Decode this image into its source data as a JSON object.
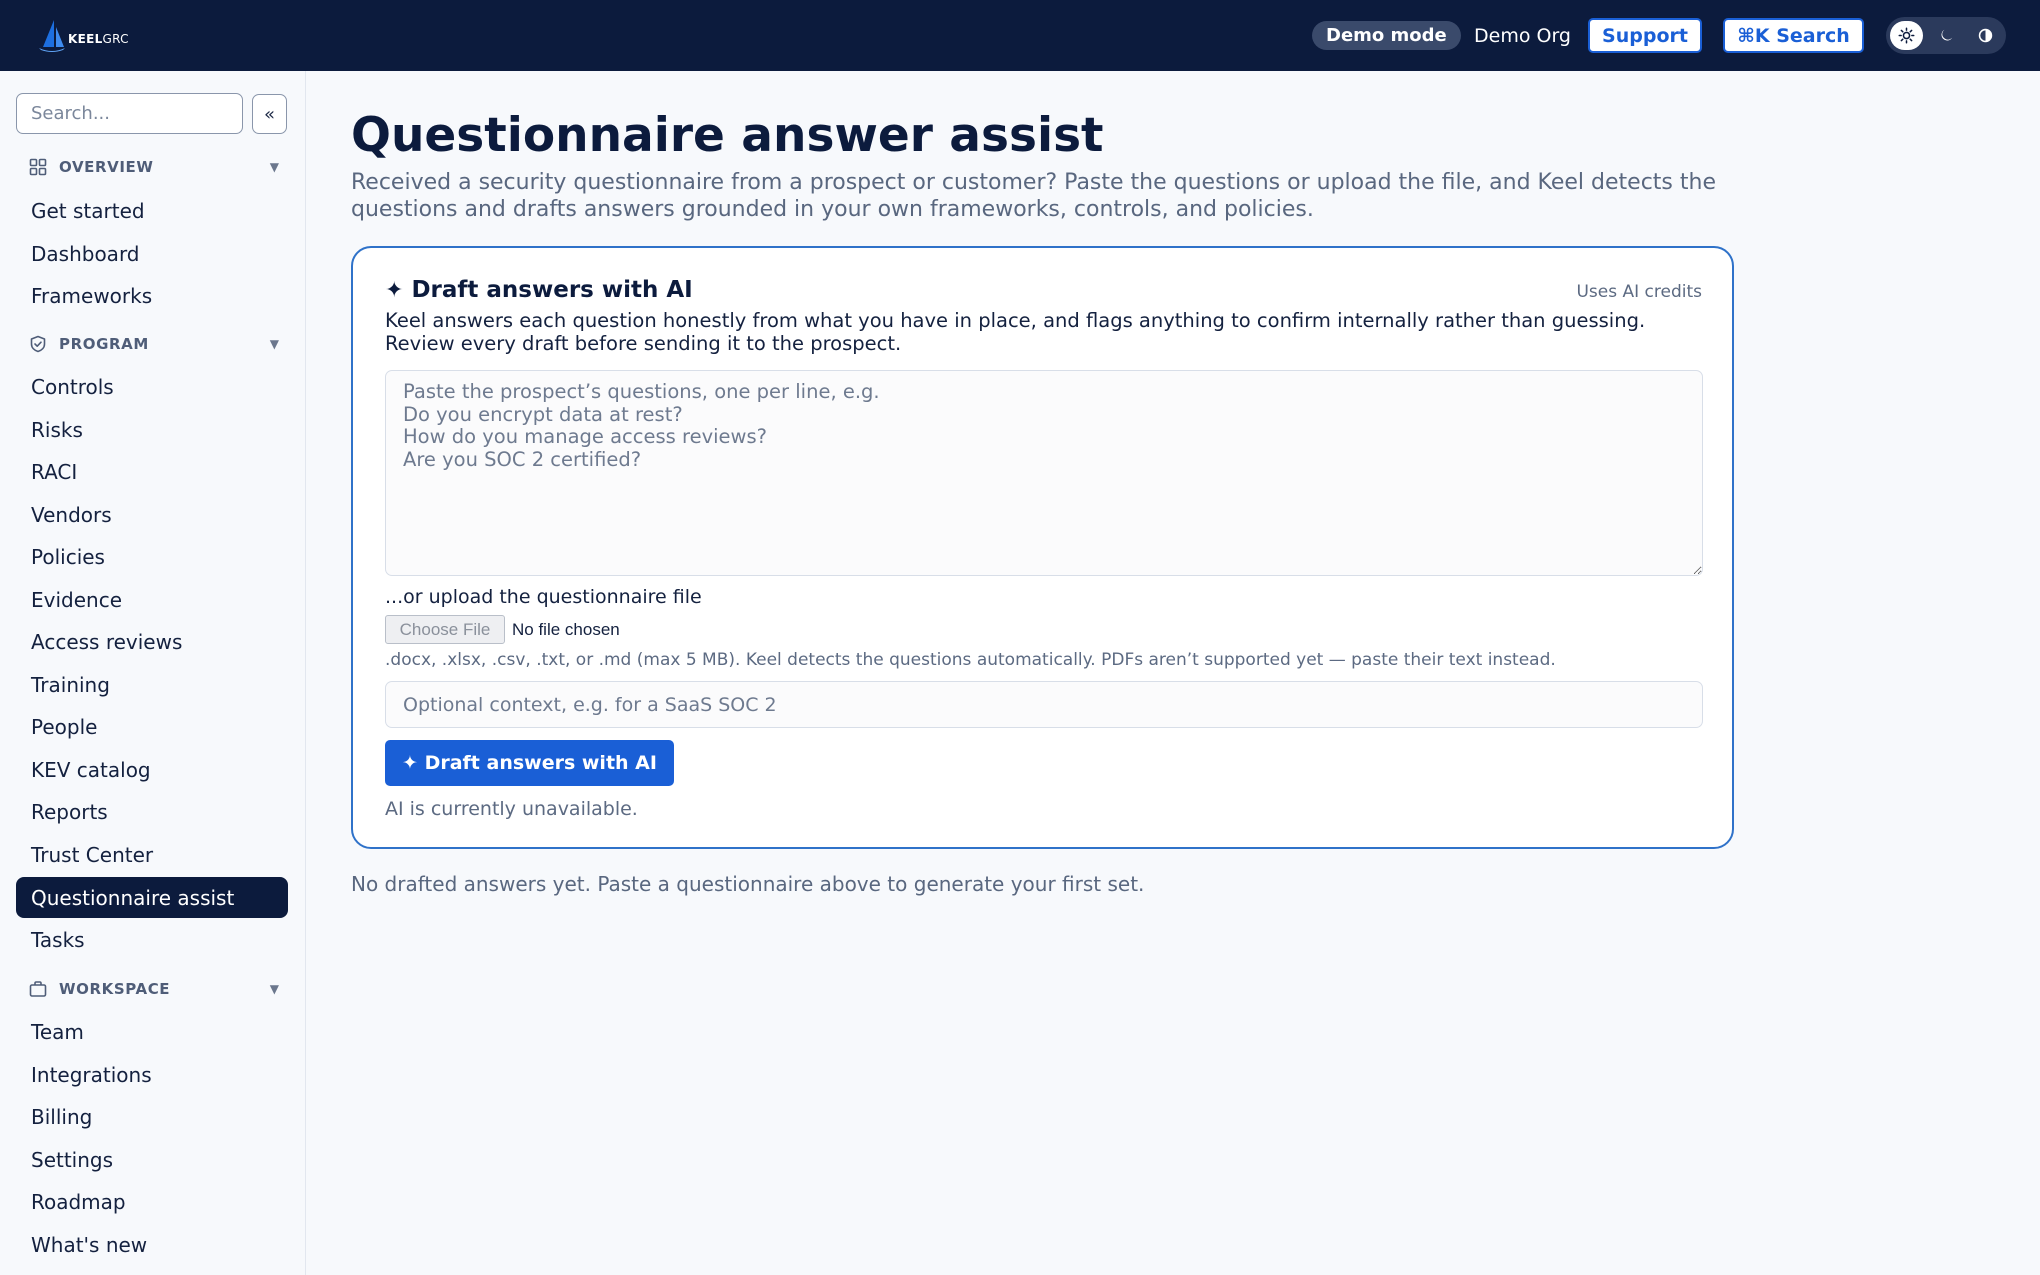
{
  "brand": {
    "name_bold": "KEEL",
    "name_light": "GRC"
  },
  "topbar": {
    "demo_badge": "Demo mode",
    "org_name": "Demo Org",
    "support_label": "Support",
    "search_label": "⌘K Search",
    "theme_options": [
      "sun-icon",
      "moon-icon",
      "contrast-icon"
    ],
    "theme_active": "sun-icon"
  },
  "sidebar": {
    "search_placeholder": "Search...",
    "collapse_label": "«",
    "sections": [
      {
        "title": "OVERVIEW",
        "icon": "grid-icon",
        "items": [
          "Get started",
          "Dashboard",
          "Frameworks"
        ]
      },
      {
        "title": "PROGRAM",
        "icon": "shield-icon",
        "items": [
          "Controls",
          "Risks",
          "RACI",
          "Vendors",
          "Policies",
          "Evidence",
          "Access reviews",
          "Training",
          "People",
          "KEV catalog",
          "Reports",
          "Trust Center",
          "Questionnaire assist",
          "Tasks"
        ]
      },
      {
        "title": "WORKSPACE",
        "icon": "briefcase-icon",
        "items": [
          "Team",
          "Integrations",
          "Billing",
          "Settings",
          "Roadmap",
          "What's new"
        ]
      }
    ],
    "active_item": "Questionnaire assist"
  },
  "main": {
    "title": "Questionnaire answer assist",
    "subtitle": "Received a security questionnaire from a prospect or customer? Paste the questions or upload the file, and Keel detects the questions and drafts answers grounded in your own frameworks, controls, and policies.",
    "card": {
      "title": "Draft answers with AI",
      "credits_note": "Uses AI credits",
      "description": "Keel answers each question honestly from what you have in place, and flags anything to confirm internally rather than guessing. Review every draft before sending it to the prospect.",
      "questions_placeholder": "Paste the prospect’s questions, one per line, e.g.\nDo you encrypt data at rest?\nHow do you manage access reviews?\nAre you SOC 2 certified?",
      "upload_label": "...or upload the questionnaire file",
      "file_button": "Choose File",
      "file_status": "No file chosen",
      "file_help": ".docx, .xlsx, .csv, .txt, or .md (max 5 MB). Keel detects the questions automatically. PDFs aren’t supported yet — paste their text instead.",
      "context_placeholder": "Optional context, e.g. for a SaaS SOC 2",
      "draft_button": "✦ Draft answers with AI",
      "ai_status": "AI is currently unavailable."
    },
    "empty_note": "No drafted answers yet. Paste a questionnaire above to generate your first set."
  },
  "colors": {
    "navy": "#0c1b3d",
    "accent": "#1a5fd6",
    "card_border": "#2f72c9"
  }
}
